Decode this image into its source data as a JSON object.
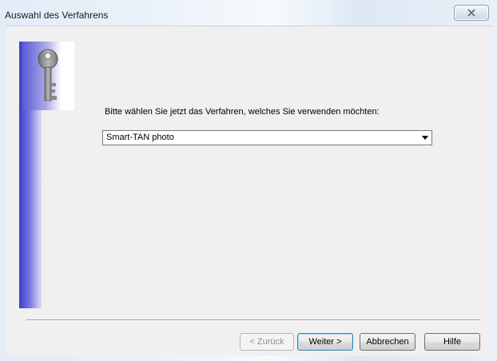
{
  "window": {
    "title": "Auswahl des Verfahrens",
    "close_glyph": "close-icon"
  },
  "content": {
    "prompt": "Bitte wählen Sie jetzt das Verfahren, welches Sie verwenden möchten:",
    "procedure_select": {
      "selected": "Smart-TAN photo"
    }
  },
  "buttons": {
    "back": "< Zurück",
    "next": "Weiter >",
    "cancel": "Abbrechen",
    "help": "Hilfe"
  },
  "icons": {
    "header": "key-icon",
    "dropdown": "chevron-down-icon"
  },
  "colors": {
    "sidebar_gradient_start": "#3c3ccb",
    "sidebar_gradient_end": "#dcdcf5",
    "default_button_border": "#3c7fb1"
  }
}
